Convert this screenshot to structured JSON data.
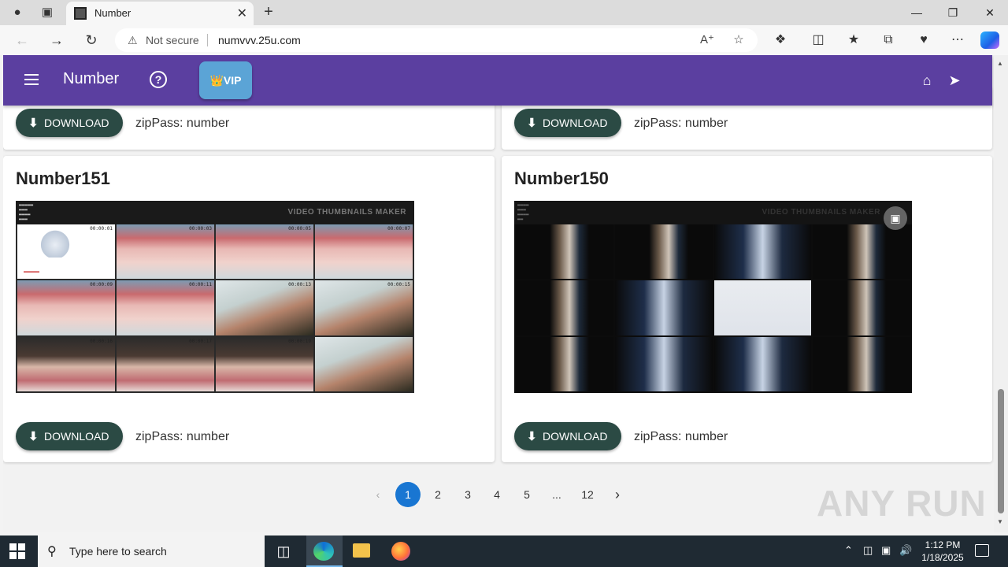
{
  "browser": {
    "tab_title": "Number",
    "not_secure": "Not secure",
    "url": "numvvv.25u.com"
  },
  "app": {
    "title": "Number",
    "vip_label": "👑VIP"
  },
  "top_cards": [
    {
      "download_label": "DOWNLOAD",
      "zip_pass": "zipPass: number"
    },
    {
      "download_label": "DOWNLOAD",
      "zip_pass": "zipPass: number"
    }
  ],
  "cards": [
    {
      "title": "Number151",
      "thumb_header": "VIDEO THUMBNAILS MAKER",
      "timestamps": [
        "00:00:01",
        "00:00:03",
        "00:00:05",
        "00:00:07",
        "00:00:09",
        "00:00:11",
        "00:00:13",
        "00:00:15",
        "00:00:16",
        "00:00:17",
        "00:00:19"
      ],
      "download_label": "DOWNLOAD",
      "zip_pass": "zipPass: number"
    },
    {
      "title": "Number150",
      "thumb_header": "VIDEO THUMBNAILS MAKER",
      "download_label": "DOWNLOAD",
      "zip_pass": "zipPass: number"
    }
  ],
  "pagination": {
    "pages": [
      "1",
      "2",
      "3",
      "4",
      "5",
      "...",
      "12"
    ],
    "current": "1"
  },
  "watermark": "ANY RUN",
  "taskbar": {
    "search_placeholder": "Type here to search",
    "time": "1:12 PM",
    "date": "1/18/2025"
  }
}
